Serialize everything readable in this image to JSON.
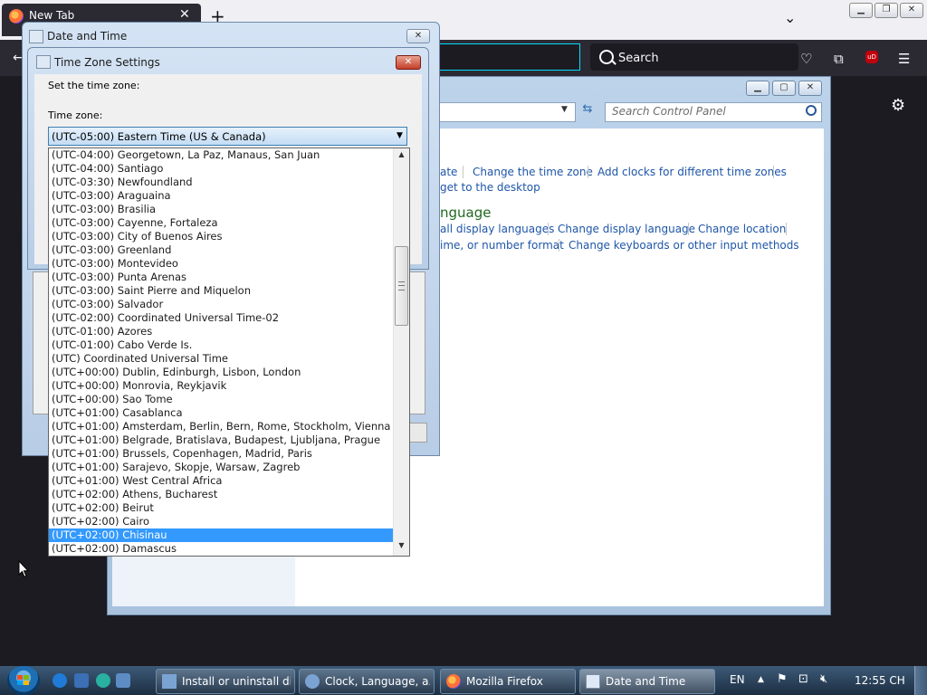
{
  "firefox": {
    "tab_title": "New Tab",
    "search_placeholder": "Search",
    "ublock_label": "uD"
  },
  "control_panel": {
    "search_placeholder": "Search Control Panel",
    "heading_language": "nguage",
    "links_row1": [
      "ate",
      "Change the time zone",
      "Add clocks for different time zones"
    ],
    "link_desktop": "get to the desktop",
    "links_row3": [
      "all display languages",
      "Change display language",
      "Change location"
    ],
    "links_row4": [
      "ime, or number format",
      "Change keyboards or other input methods"
    ]
  },
  "date_time_dialog": {
    "title": "Date and Time"
  },
  "time_zone_dialog": {
    "title": "Time Zone Settings",
    "set_label": "Set the time zone:",
    "zone_label": "Time zone:",
    "selected_value": "(UTC-05:00) Eastern Time (US & Canada)",
    "highlighted_option": "(UTC+02:00) Chisinau",
    "options": [
      "(UTC-04:00) Georgetown, La Paz, Manaus, San Juan",
      "(UTC-04:00) Santiago",
      "(UTC-03:30) Newfoundland",
      "(UTC-03:00) Araguaina",
      "(UTC-03:00) Brasilia",
      "(UTC-03:00) Cayenne, Fortaleza",
      "(UTC-03:00) City of Buenos Aires",
      "(UTC-03:00) Greenland",
      "(UTC-03:00) Montevideo",
      "(UTC-03:00) Punta Arenas",
      "(UTC-03:00) Saint Pierre and Miquelon",
      "(UTC-03:00) Salvador",
      "(UTC-02:00) Coordinated Universal Time-02",
      "(UTC-01:00) Azores",
      "(UTC-01:00) Cabo Verde Is.",
      "(UTC) Coordinated Universal Time",
      "(UTC+00:00) Dublin, Edinburgh, Lisbon, London",
      "(UTC+00:00) Monrovia, Reykjavik",
      "(UTC+00:00) Sao Tome",
      "(UTC+01:00) Casablanca",
      "(UTC+01:00) Amsterdam, Berlin, Bern, Rome, Stockholm, Vienna",
      "(UTC+01:00) Belgrade, Bratislava, Budapest, Ljubljana, Prague",
      "(UTC+01:00) Brussels, Copenhagen, Madrid, Paris",
      "(UTC+01:00) Sarajevo, Skopje, Warsaw, Zagreb",
      "(UTC+01:00) West Central Africa",
      "(UTC+02:00) Athens, Bucharest",
      "(UTC+02:00) Beirut",
      "(UTC+02:00) Cairo",
      "(UTC+02:00) Chisinau",
      "(UTC+02:00) Damascus"
    ]
  },
  "taskbar": {
    "buttons": [
      {
        "label": "Install or uninstall di...",
        "icon": "control-panel-icon"
      },
      {
        "label": "Clock, Language, a...",
        "icon": "clock-language-icon"
      },
      {
        "label": "Mozilla Firefox",
        "icon": "firefox-icon"
      },
      {
        "label": "Date and Time",
        "icon": "date-time-icon"
      }
    ],
    "language": "EN",
    "clock": "12:55 CH"
  }
}
